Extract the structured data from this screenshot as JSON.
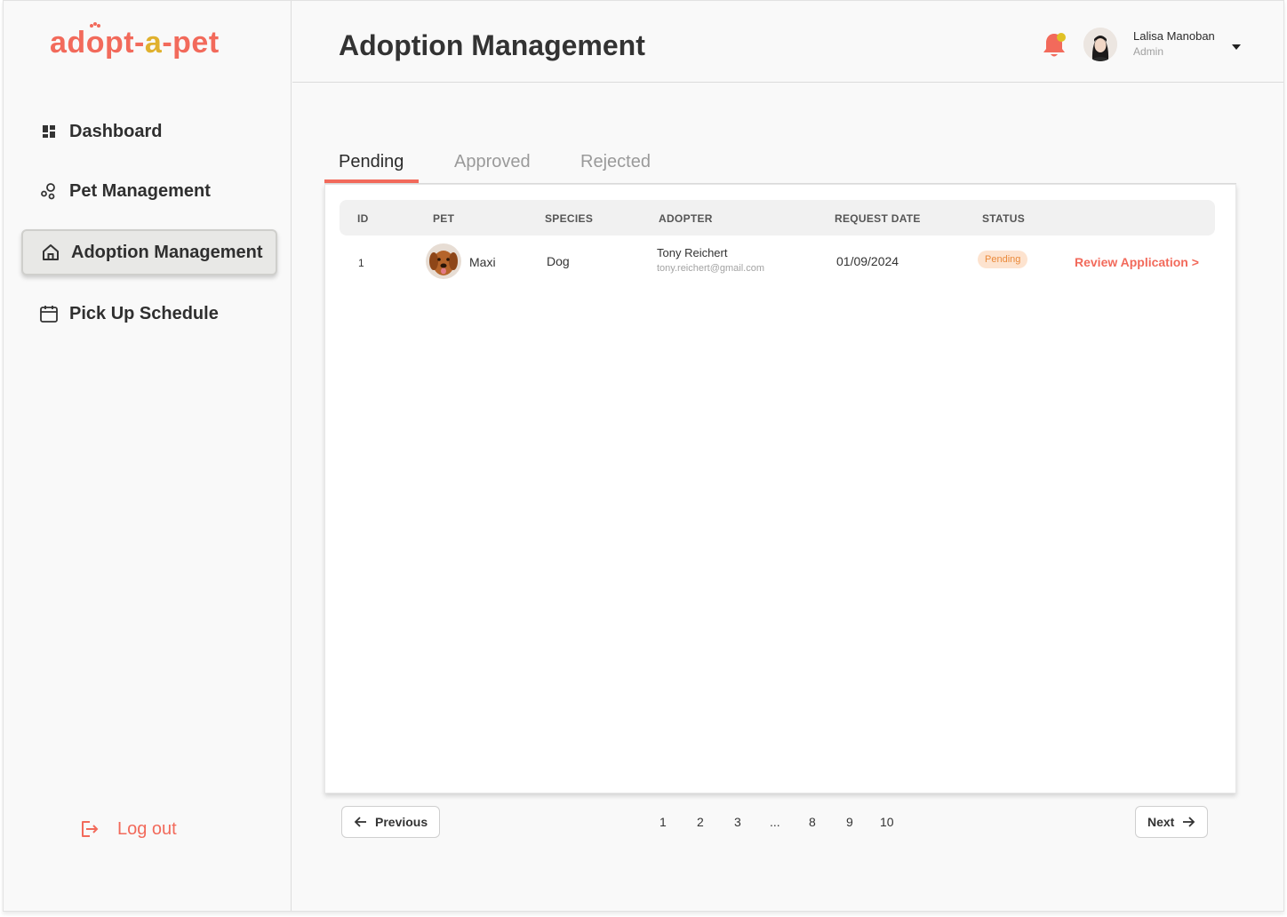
{
  "brand": {
    "part1": "adopt-a-",
    "part2": "pet",
    "highlight": "a"
  },
  "sidebar": {
    "items": [
      {
        "label": "Dashboard",
        "icon": "dashboard-grid-icon",
        "active": false
      },
      {
        "label": "Pet Management",
        "icon": "pet-circles-icon",
        "active": false
      },
      {
        "label": "Adoption Management",
        "icon": "home-icon",
        "active": true
      },
      {
        "label": "Pick Up Schedule",
        "icon": "calendar-icon",
        "active": false
      }
    ],
    "logout_label": "Log out"
  },
  "header": {
    "title": "Adoption Management",
    "user": {
      "name": "Lalisa Manoban",
      "role": "Admin"
    }
  },
  "tabs": [
    "Pending",
    "Approved",
    "Rejected"
  ],
  "table": {
    "columns": [
      "ID",
      "PET",
      "SPECIES",
      "ADOPTER",
      "REQUEST DATE",
      "STATUS"
    ],
    "rows": [
      {
        "id": "1",
        "pet": "Maxi",
        "species": "Dog",
        "adopter_name": "Tony Reichert",
        "adopter_email": "tony.reichert@gmail.com",
        "request_date": "01/09/2024",
        "status": "Pending",
        "action": "Review Application >"
      }
    ]
  },
  "pagination": {
    "previous": "Previous",
    "next": "Next",
    "pages": [
      "1",
      "2",
      "3",
      "...",
      "8",
      "9",
      "10"
    ]
  },
  "colors": {
    "accent": "#f26a5b",
    "brand_yellow": "#e0b12e",
    "badge_bg": "#fde3cf",
    "badge_text": "#ea8a3b"
  }
}
